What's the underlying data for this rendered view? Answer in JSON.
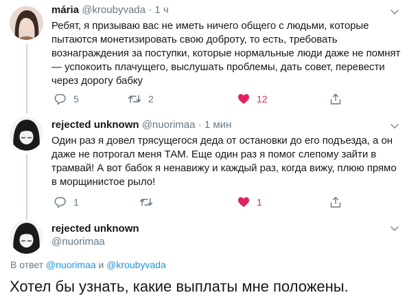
{
  "tweets": [
    {
      "name": "mária",
      "handle": "@kroubyvada",
      "time": "1 ч",
      "text": "Ребят, я призываю вас не иметь ничего общего с людьми, которые пытаются монетизировать свою доброту, то есть, требовать вознаграждения за поступки, которые нормальные люди даже не помнят — успокоить плачущего, выслушать проблемы, дать совет, перевести через дорогу бабку",
      "replies": "5",
      "retweets": "2",
      "likes": "12"
    },
    {
      "name": "rejected unknown",
      "handle": "@nuorimaa",
      "time": "1 мин",
      "text": "Один раз я довел трясущегося деда от остановки до его подъезда, а он даже не потрогал меня ТАМ. Еще один раз я помог слепому зайти в трамвай! А вот бабок я ненавижу и каждый раз, когда вижу, плюю прямо в морщинистое рыло!",
      "replies": "1",
      "retweets": "",
      "likes": "1"
    }
  ],
  "main": {
    "name": "rejected unknown",
    "handle": "@nuorimaa",
    "reply_prefix": "В ответ",
    "reply_user1": "@nuorimaa",
    "reply_and": "и",
    "reply_user2": "@kroubyvada",
    "text": "Хотел бы узнать, какие выплаты мне положены."
  },
  "colors": {
    "accent": "#1b95e0",
    "like": "#e0245e",
    "muted": "#657786"
  },
  "icons": [
    "reply-icon",
    "retweet-icon",
    "heart-icon",
    "share-icon",
    "chevron-down-icon"
  ]
}
